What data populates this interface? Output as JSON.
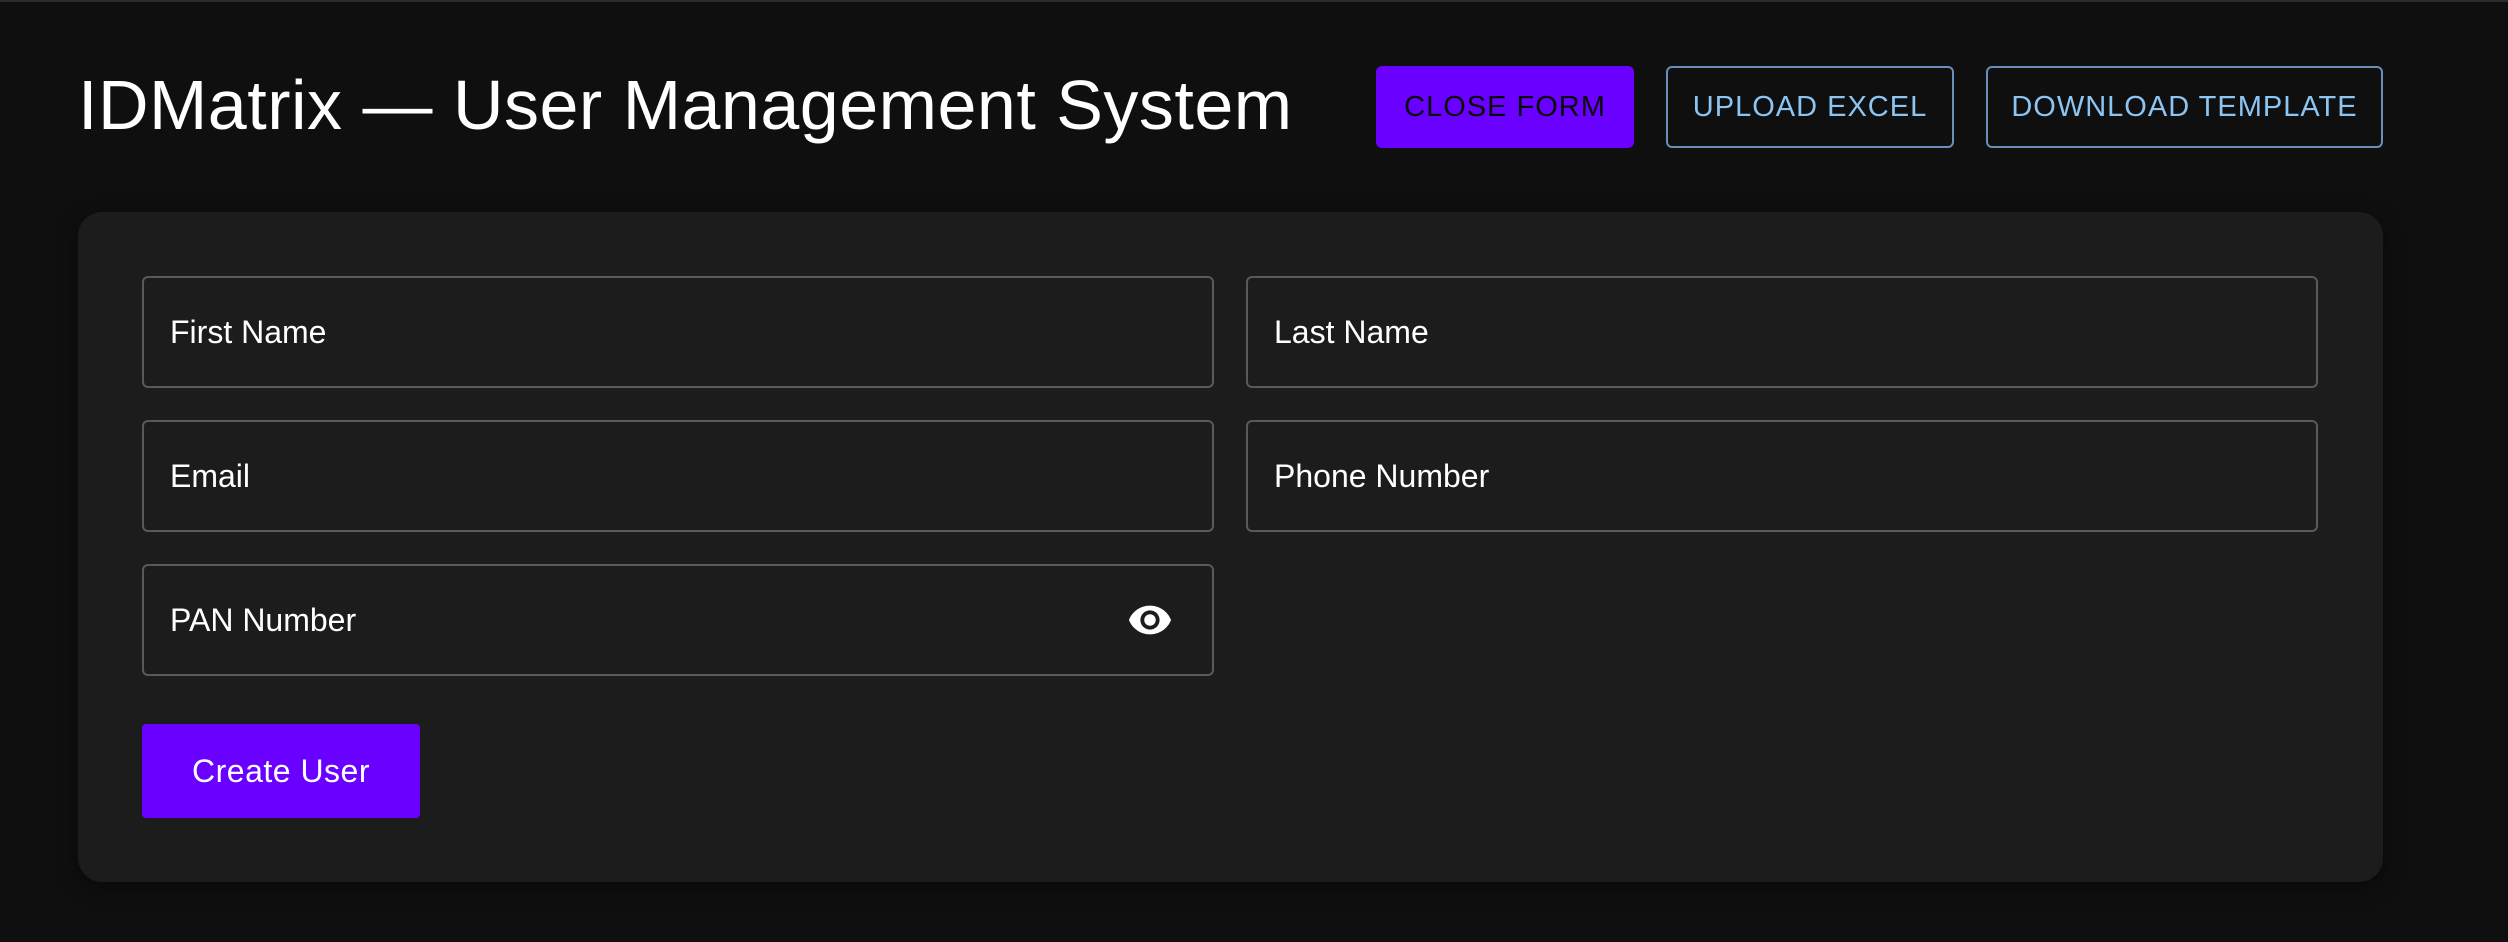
{
  "header": {
    "title": "IDMatrix — User Management System",
    "buttons": {
      "close_form": "CLOSE FORM",
      "upload_excel": "UPLOAD EXCEL",
      "download_template": "DOWNLOAD TEMPLATE"
    }
  },
  "form": {
    "fields": {
      "first_name": {
        "placeholder": "First Name",
        "value": ""
      },
      "last_name": {
        "placeholder": "Last Name",
        "value": ""
      },
      "email": {
        "placeholder": "Email",
        "value": ""
      },
      "phone_number": {
        "placeholder": "Phone Number",
        "value": ""
      },
      "pan_number": {
        "placeholder": "PAN Number",
        "value": "",
        "toggle_icon": "eye-icon"
      }
    },
    "submit_label": "Create User"
  },
  "colors": {
    "background": "#0f0f0f",
    "card": "#1c1c1c",
    "primary": "#6a00ff",
    "outline_text": "#8cc4f2",
    "outline_border": "#6a8fb8",
    "field_border": "#5a5a5a"
  }
}
